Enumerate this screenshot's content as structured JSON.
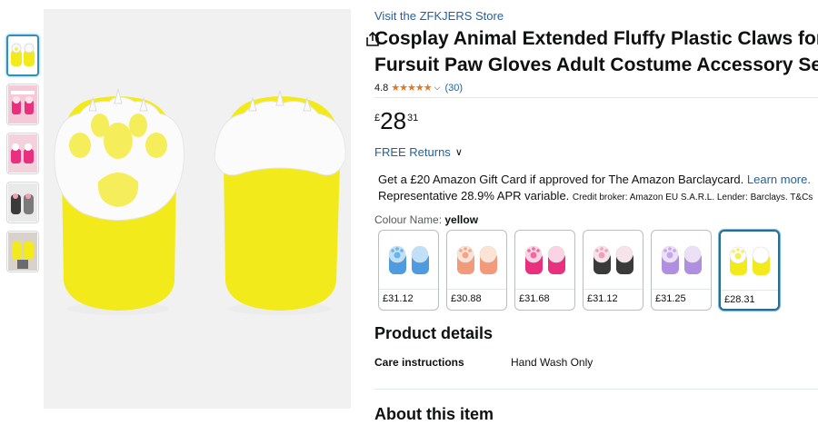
{
  "gallery": {
    "thumbnails": [
      {
        "name": "thumb-yellow-paws",
        "active": true
      },
      {
        "name": "thumb-pink-infographic",
        "active": false
      },
      {
        "name": "thumb-pink-closeup",
        "active": false
      },
      {
        "name": "thumb-black-paws",
        "active": false
      },
      {
        "name": "thumb-on-hands",
        "active": false
      }
    ]
  },
  "store_link": "Visit the ZFKJERS Store",
  "title_lines": [
    "Cosplay Animal Extended Fluffy Plastic Claws for C",
    "Fursuit Paw Gloves Adult Costume Accessory Set"
  ],
  "rating": {
    "value": "4.8",
    "stars": "★★★★★",
    "count": "(30)"
  },
  "price": {
    "symbol": "£",
    "whole": "28",
    "fraction": "31"
  },
  "returns": "FREE Returns",
  "gift": {
    "line1_text": "Get a £20 Amazon Gift Card if approved for The Amazon Barclaycard.",
    "line1_link": "Learn more.",
    "line2_text": "Representative 28.9% APR variable.",
    "line2_small": "Credit broker: Amazon EU S.A.R.L. Lender: Barclays. T&Cs"
  },
  "colour": {
    "label": "Colour Name:",
    "selected": "yellow"
  },
  "swatches": [
    {
      "name": "blue",
      "price": "£31.12",
      "palm": "#bfe0f7",
      "fur": "#4f9be0",
      "pad": "#6bb3e8",
      "selected": false
    },
    {
      "name": "orange",
      "price": "£30.88",
      "palm": "#fde3d6",
      "fur": "#f29a7a",
      "pad": "#f4a48a",
      "selected": false
    },
    {
      "name": "pink",
      "price": "£31.68",
      "palm": "#fcd3e4",
      "fur": "#e8307f",
      "pad": "#f06aa0",
      "selected": false
    },
    {
      "name": "black",
      "price": "£31.12",
      "palm": "#f7e4ea",
      "fur": "#3a3a3a",
      "pad": "#f2a0b8",
      "selected": false
    },
    {
      "name": "purple",
      "price": "£31.25",
      "palm": "#ece0f7",
      "fur": "#b08ee0",
      "pad": "#c5a8ec",
      "selected": false
    },
    {
      "name": "yellow",
      "price": "£28.31",
      "palm": "#ffffff",
      "fur": "#f2ea1a",
      "pad": "#f5ee5a",
      "selected": true
    }
  ],
  "product_details": {
    "heading": "Product details",
    "rows": [
      {
        "key": "Care instructions",
        "value": "Hand Wash Only"
      }
    ]
  },
  "about_heading": "About this item"
}
